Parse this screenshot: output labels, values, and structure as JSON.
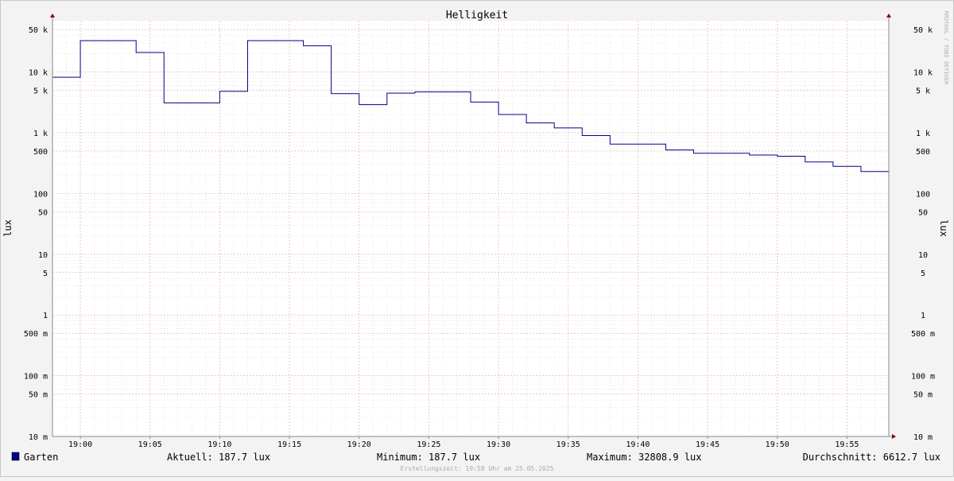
{
  "chart_data": {
    "type": "line",
    "title": "Helligkeit",
    "ylabel": "lux",
    "ylabel_right": "lux",
    "yscale": "log",
    "ylim": [
      0.01,
      70000
    ],
    "xlim": [
      "18:58",
      "19:58"
    ],
    "grid": true,
    "watermark": "RRDTOOL / TOBI OETIKER",
    "footer": "Erstellungszeit: 19:58 Uhr am 25.05.2025",
    "x_ticks": [
      {
        "t": 60,
        "label": "19:00"
      },
      {
        "t": 65,
        "label": "19:05"
      },
      {
        "t": 70,
        "label": "19:10"
      },
      {
        "t": 75,
        "label": "19:15"
      },
      {
        "t": 80,
        "label": "19:20"
      },
      {
        "t": 85,
        "label": "19:25"
      },
      {
        "t": 90,
        "label": "19:30"
      },
      {
        "t": 95,
        "label": "19:35"
      },
      {
        "t": 100,
        "label": "19:40"
      },
      {
        "t": 105,
        "label": "19:45"
      },
      {
        "t": 110,
        "label": "19:50"
      },
      {
        "t": 115,
        "label": "19:55"
      }
    ],
    "y_ticks": [
      {
        "v": 50000,
        "label": "50 k"
      },
      {
        "v": 10000,
        "label": "10 k"
      },
      {
        "v": 5000,
        "label": "5 k"
      },
      {
        "v": 1000,
        "label": "1 k"
      },
      {
        "v": 500,
        "label": "500"
      },
      {
        "v": 100,
        "label": "100"
      },
      {
        "v": 50,
        "label": "50"
      },
      {
        "v": 10,
        "label": "10"
      },
      {
        "v": 5,
        "label": "5"
      },
      {
        "v": 1,
        "label": "1"
      },
      {
        "v": 0.5,
        "label": "500 m"
      },
      {
        "v": 0.1,
        "label": "100 m"
      },
      {
        "v": 0.05,
        "label": "50 m"
      },
      {
        "v": 0.01,
        "label": "10 m"
      }
    ],
    "series": [
      {
        "name": "Garten",
        "color": "#00008b",
        "x": [
          "18:58",
          "19:00",
          "19:02",
          "19:04",
          "19:06",
          "19:08",
          "19:10",
          "19:12",
          "19:14",
          "19:16",
          "19:18",
          "19:20",
          "19:22",
          "19:24",
          "19:26",
          "19:28",
          "19:30",
          "19:32",
          "19:34",
          "19:36",
          "19:38",
          "19:40",
          "19:42",
          "19:44",
          "19:46",
          "19:48",
          "19:50",
          "19:52",
          "19:54",
          "19:56",
          "19:58"
        ],
        "values": [
          8200,
          32808.9,
          32808.9,
          21000,
          3100,
          3100,
          4800,
          32808.9,
          32808.9,
          27000,
          4400,
          2900,
          4500,
          4700,
          4700,
          3200,
          2000,
          1450,
          1200,
          900,
          650,
          650,
          520,
          460,
          460,
          430,
          410,
          330,
          280,
          230,
          187.7
        ]
      }
    ],
    "legend": {
      "color": "#00008b",
      "name": "Garten",
      "current": "Aktuell: 187.7 lux",
      "minimum": "Minimum: 187.7 lux",
      "maximum": "Maximum: 32808.9 lux",
      "average": "Durchschnitt: 6612.7 lux"
    }
  }
}
